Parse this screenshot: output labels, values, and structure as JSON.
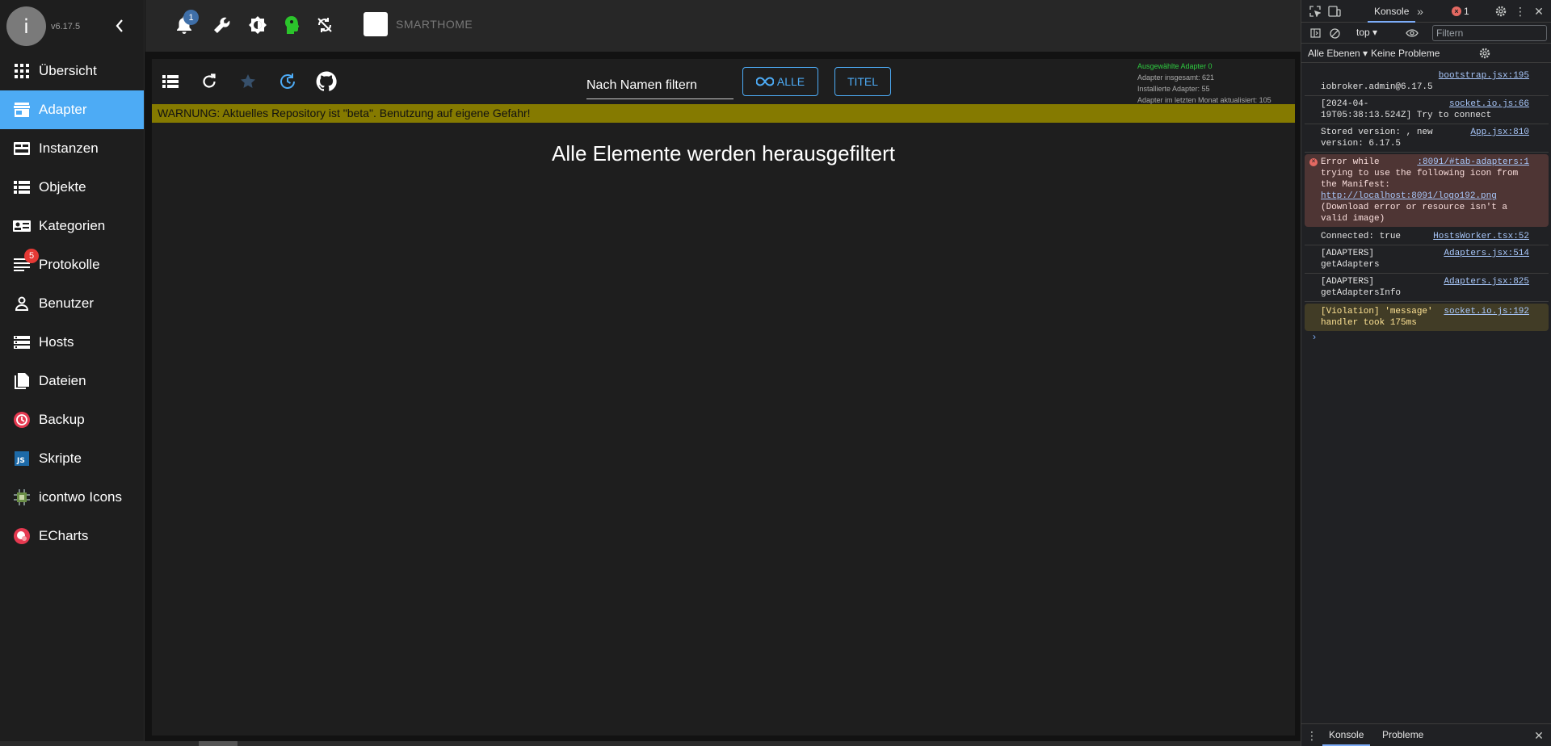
{
  "sidebar": {
    "avatar_letter": "i",
    "version": "v6.17.5",
    "items": [
      {
        "label": "Übersicht"
      },
      {
        "label": "Adapter"
      },
      {
        "label": "Instanzen"
      },
      {
        "label": "Objekte"
      },
      {
        "label": "Kategorien"
      },
      {
        "label": "Protokolle",
        "badge": "5"
      },
      {
        "label": "Benutzer"
      },
      {
        "label": "Hosts"
      },
      {
        "label": "Dateien"
      },
      {
        "label": "Backup"
      },
      {
        "label": "Skripte"
      },
      {
        "label": "icontwo Icons"
      },
      {
        "label": "ECharts"
      }
    ]
  },
  "topbar": {
    "notifications_badge": "1",
    "brand": "SMARTHOME"
  },
  "main": {
    "filter_placeholder": "Nach Namen filtern",
    "all_button": "ALLE",
    "title_button": "TITEL",
    "stats": {
      "selected": "Ausgewählte Adapter 0",
      "total": "Adapter insgesamt: 621",
      "installed": "Installierte Adapter: 55",
      "updated": "Adapter im letzten Monat aktualisiert: 105"
    },
    "warning": "WARNUNG: Aktuelles Repository ist \"beta\". Benutzung auf eigene Gefahr!",
    "empty_message": "Alle Elemente werden herausgefiltert"
  },
  "devtools": {
    "tab_console": "Konsole",
    "error_count": "1",
    "context": "top",
    "filter_placeholder": "Filtern",
    "levels": "Alle Ebenen",
    "issues": "Keine Probleme",
    "messages": [
      {
        "type": "log",
        "text": "iobroker.admin@6.17.5",
        "src": "bootstrap.jsx:195"
      },
      {
        "type": "log",
        "text": "[2024-04-19T05:38:13.524Z] Try to connect",
        "src": "socket.io.js:66"
      },
      {
        "type": "log",
        "text": "Stored version: , new version: 6.17.5",
        "src": "App.jsx:810"
      },
      {
        "type": "error",
        "text_a": "Error while trying to use the following icon from the Manifest: ",
        "link": "http://localhost:8091/logo192.png",
        "text_b": " (Download error or resource isn't a valid image)",
        "src": ":8091/#tab-adapters:1"
      },
      {
        "type": "log",
        "text": "Connected: true",
        "src": "HostsWorker.tsx:52"
      },
      {
        "type": "log",
        "text": "[ADAPTERS] getAdapters",
        "src": "Adapters.jsx:514"
      },
      {
        "type": "log",
        "text": "[ADAPTERS] getAdaptersInfo",
        "src": "Adapters.jsx:825"
      },
      {
        "type": "warn",
        "text": "[Violation] 'message' handler took 175ms",
        "src": "socket.io.js:192"
      }
    ],
    "bottom_console": "Konsole",
    "bottom_issues": "Probleme"
  },
  "colors": {
    "accent": "#4dabf5",
    "warning_bg": "#857a00",
    "badge_red": "#e53935"
  }
}
